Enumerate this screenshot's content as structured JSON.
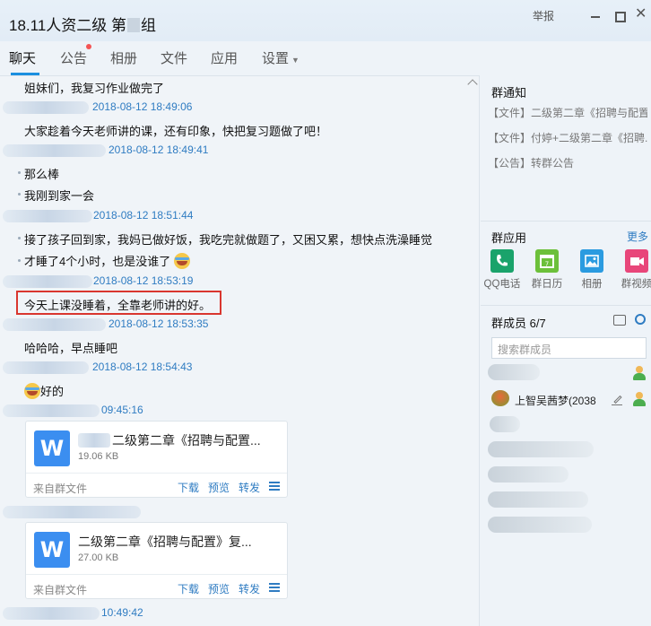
{
  "window": {
    "title_prefix": "18.11人资二级 第",
    "title_suffix": "组",
    "report_label": "举报",
    "close_glyph": "✕"
  },
  "tabs": [
    {
      "label": "聊天"
    },
    {
      "label": "公告"
    },
    {
      "label": "相册"
    },
    {
      "label": "文件"
    },
    {
      "label": "应用"
    },
    {
      "label": "设置"
    }
  ],
  "messages": {
    "m1": "姐妹们，我复习作业做完了",
    "t1": "2018-08-12 18:49:06",
    "m2": "大家趁着今天老师讲的课，还有印象，快把复习题做了吧！",
    "t2": "2018-08-12 18:49:41",
    "m3": "那么棒",
    "m4": "我刚到家一会",
    "t3": "2018-08-12 18:51:44",
    "m5": "接了孩子回到家，我妈已做好饭，我吃完就做题了，又困又累，想快点洗澡睡觉",
    "m6": "才睡了4个小时，也是没谁了",
    "t4": "2018-08-12 18:53:19",
    "m7": "今天上课没睡着，全靠老师讲的好。",
    "t5": "2018-08-12 18:53:35",
    "m8": "哈哈哈，早点睡吧",
    "t6": "2018-08-12 18:54:43",
    "m9": "好的",
    "t7": "09:45:16",
    "t8": "10:49:42"
  },
  "files": [
    {
      "icon_letter": "W",
      "name": "二级第二章《招聘与配置...",
      "size": "19.06 KB",
      "source": "来自群文件",
      "download": "下载",
      "preview": "预览",
      "forward": "转发"
    },
    {
      "icon_letter": "W",
      "name": "二级第二章《招聘与配置》复...",
      "size": "27.00 KB",
      "source": "来自群文件",
      "download": "下载",
      "preview": "预览",
      "forward": "转发"
    }
  ],
  "sidebar": {
    "notice_title": "群通知",
    "notices": [
      "【文件】二级第二章《招聘与配置...",
      "【文件】付婷+二级第二章《招聘...",
      "【公告】转群公告"
    ],
    "apps_title": "群应用",
    "more_label": "更多",
    "apps": [
      {
        "label": "QQ电话",
        "color": "#1aa36b"
      },
      {
        "label": "群日历",
        "color": "#6cc03a"
      },
      {
        "label": "相册",
        "color": "#2b9be0"
      },
      {
        "label": "群视频",
        "color": "#e8467a"
      }
    ],
    "members_title": "群成员 6/7",
    "search_placeholder": "搜索群成员",
    "member_visible_name": "上智吴茜梦(2038"
  }
}
